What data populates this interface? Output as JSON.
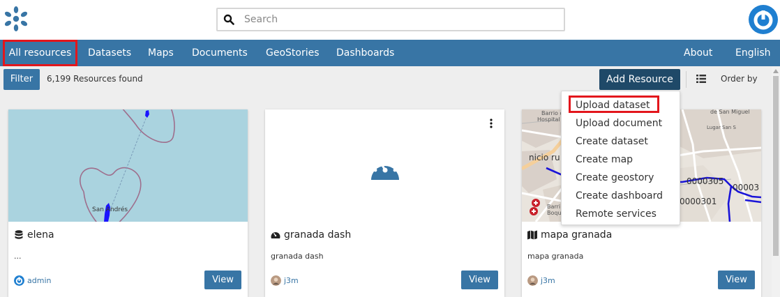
{
  "header": {
    "logo_icon": "geonode-logo-icon",
    "search_placeholder": "Search",
    "user_icon": "user-avatar-icon",
    "brand_color": "#3875a5"
  },
  "nav": {
    "left": [
      {
        "label": "All resources",
        "active": true
      },
      {
        "label": "Datasets"
      },
      {
        "label": "Maps"
      },
      {
        "label": "Documents"
      },
      {
        "label": "GeoStories"
      },
      {
        "label": "Dashboards"
      }
    ],
    "right": [
      {
        "label": "About"
      },
      {
        "label": "English"
      }
    ]
  },
  "toolbar": {
    "filter_label": "Filter",
    "count_text": "6,199 Resources found",
    "add_resource_label": "Add Resource",
    "order_by_label": "Order by"
  },
  "add_menu": {
    "items": [
      "Upload dataset",
      "Upload document",
      "Create dataset",
      "Create map",
      "Create geostory",
      "Create dashboard",
      "Remote services"
    ],
    "highlighted_index": 0
  },
  "cards": [
    {
      "title": "elena",
      "type_icon": "database-icon",
      "description": "...",
      "owner": "admin",
      "owner_icon": "geonode-avatar-icon",
      "view_label": "View",
      "thumb_text": "San Andrés"
    },
    {
      "title": "granada dash",
      "type_icon": "dashboard-icon",
      "description": "granada dash",
      "owner": "j3m",
      "owner_icon": "user-photo-icon",
      "view_label": "View"
    },
    {
      "title": "mapa granada",
      "type_icon": "map-icon",
      "description": "mapa granada",
      "owner": "j3m",
      "owner_icon": "user-photo-icon",
      "view_label": "View"
    }
  ],
  "map_labels": {
    "barrio_hospital": [
      "Barrio d",
      "Hospital R"
    ],
    "san_miguel": "de San Miguel",
    "lugar": "Lugar San S",
    "barrio_boq": [
      "Barri",
      "Boqu"
    ],
    "inicio": "nicio ru",
    "codes": [
      "0000305",
      "0000301",
      "00003"
    ]
  }
}
